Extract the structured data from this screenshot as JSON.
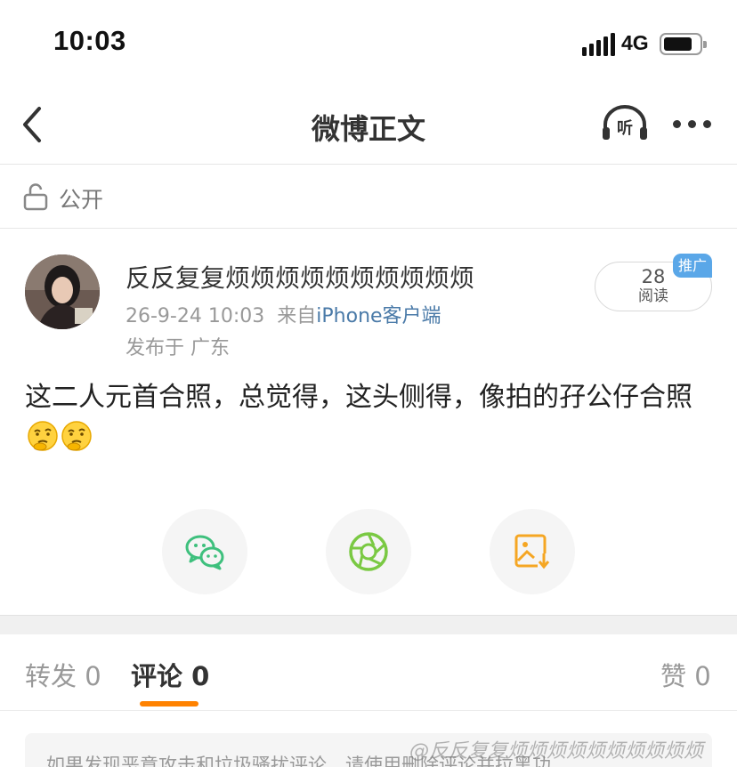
{
  "status_bar": {
    "time": "10:03",
    "network": "4G"
  },
  "nav": {
    "title": "微博正文",
    "listen_icon_text": "听"
  },
  "visibility": {
    "label": "公开"
  },
  "post": {
    "author": "反反复复烦烦烦烦烦烦烦烦烦烦",
    "date": "26-9-24 10:03",
    "source_prefix": "来自",
    "client": "iPhone客户端",
    "location": "发布于 广东",
    "read_count": "28",
    "read_label": "阅读",
    "promote_badge": "推广",
    "body": "这二人元首合照，总觉得，这头侧得，像拍的孖公仔合照"
  },
  "tabs": [
    {
      "label": "转发",
      "count": "0"
    },
    {
      "label": "评论",
      "count": "0"
    },
    {
      "label": "赞",
      "count": "0"
    }
  ],
  "notice": {
    "text": "如果发现恶意攻击和垃圾骚扰评论，请使用删除评论并拉黑功"
  },
  "watermark": "@反反复复烦烦烦烦烦烦烦烦烦烦",
  "colors": {
    "accent": "#ff8200",
    "link": "#4a7aa8",
    "wechat": "#3ec07d",
    "moments": "#7ac943",
    "save": "#f5a623"
  }
}
